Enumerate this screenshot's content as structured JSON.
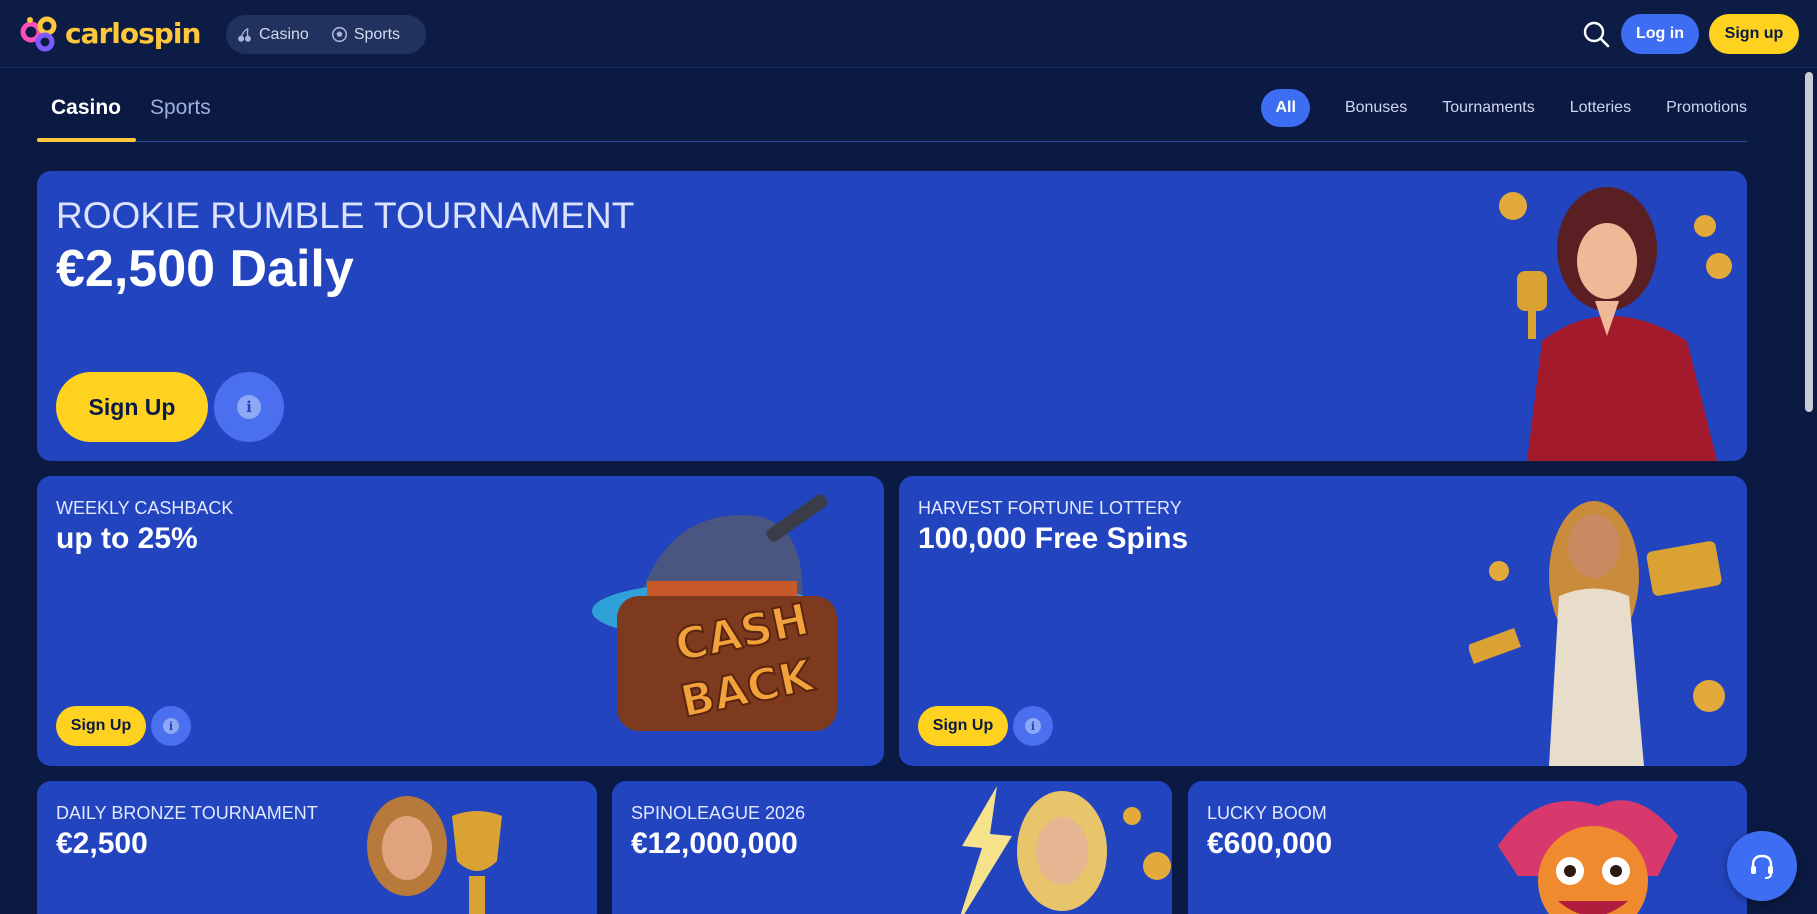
{
  "header": {
    "brand": "carlospin",
    "verticals": [
      {
        "label": "Casino",
        "icon": "cherries-icon"
      },
      {
        "label": "Sports",
        "icon": "soccer-ball-icon"
      }
    ],
    "login_label": "Log in",
    "signup_label": "Sign up"
  },
  "subnav": {
    "tabs": [
      {
        "label": "Casino",
        "active": true
      },
      {
        "label": "Sports",
        "active": false
      }
    ],
    "filters": [
      {
        "label": "All",
        "active": true
      },
      {
        "label": "Bonuses"
      },
      {
        "label": "Tournaments"
      },
      {
        "label": "Lotteries"
      },
      {
        "label": "Promotions"
      }
    ]
  },
  "promos": {
    "hero": {
      "kicker": "ROOKIE RUMBLE TOURNAMENT",
      "title": "€2,500 Daily",
      "cta": "Sign Up",
      "info": "i"
    },
    "cashback": {
      "kicker": "WEEKLY CASHBACK",
      "title": "up to 25%",
      "cta": "Sign Up",
      "info": "i",
      "art_text_1": "CASH",
      "art_text_2": "BACK"
    },
    "harvest": {
      "kicker": "HARVEST FORTUNE LOTTERY",
      "title": "100,000 Free Spins",
      "cta": "Sign Up",
      "info": "i"
    },
    "bronze": {
      "kicker": "DAILY BRONZE TOURNAMENT",
      "title": "€2,500"
    },
    "spino": {
      "kicker": "SPINOLEAGUE 2026",
      "title": "€12,000,000"
    },
    "lucky": {
      "kicker": "LUCKY BOOM",
      "title": "€600,000"
    }
  },
  "colors": {
    "page_bg": "#0b1a42",
    "card_bg": "#2244bf",
    "accent_yellow": "#ffd21f",
    "accent_blue": "#3d6df2"
  }
}
